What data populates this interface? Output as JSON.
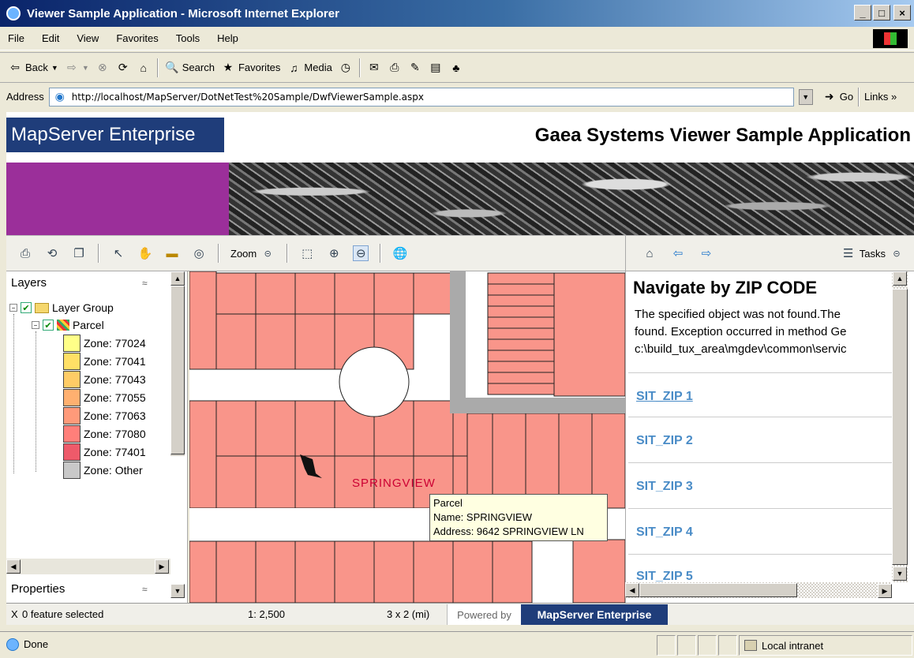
{
  "window": {
    "title": "Viewer Sample Application - Microsoft Internet Explorer",
    "controls": [
      "_",
      "□",
      "×"
    ]
  },
  "menu": [
    "File",
    "Edit",
    "View",
    "Favorites",
    "Tools",
    "Help"
  ],
  "toolbar": {
    "back": "Back",
    "search": "Search",
    "favorites": "Favorites",
    "media": "Media"
  },
  "address": {
    "label": "Address",
    "url": "http://localhost/MapServer/DotNetTest%20Sample/DwfViewerSample.aspx",
    "go": "Go",
    "links": "Links »"
  },
  "header": {
    "brand": "MapServer Enterprise",
    "app_title": "Gaea Systems Viewer Sample Application"
  },
  "map_toolbar": {
    "zoom_label": "Zoom",
    "tasks_label": "Tasks"
  },
  "layers": {
    "title": "Layers",
    "group": "Layer Group",
    "layer": "Parcel",
    "zones": [
      {
        "label": "Zone: 77024",
        "color": "#ffff88"
      },
      {
        "label": "Zone: 77041",
        "color": "#ffe066"
      },
      {
        "label": "Zone: 77043",
        "color": "#ffcc66"
      },
      {
        "label": "Zone: 77055",
        "color": "#ffb070"
      },
      {
        "label": "Zone: 77063",
        "color": "#ff9a7a"
      },
      {
        "label": "Zone: 77080",
        "color": "#ff7f7a"
      },
      {
        "label": "Zone:  77401",
        "color": "#ee5a6a"
      },
      {
        "label": "Zone: Other",
        "color": "#c8c8c8"
      }
    ]
  },
  "properties": {
    "title": "Properties"
  },
  "map": {
    "street_label": "SPRINGVIEW",
    "tooltip": {
      "line1": "Parcel",
      "line2": "Name: SPRINGVIEW",
      "line3": "Address: 9642 SPRINGVIEW LN"
    },
    "parcel_color": "#f9958a"
  },
  "task_pane": {
    "title": "Navigate by ZIP CODE",
    "error_lines": [
      "The specified object was not found.The",
      "found. Exception occurred in method Ge",
      "c:\\build_tux_area\\mgdev\\common\\servic"
    ],
    "zips": [
      "SIT_ZIP 1",
      "SIT_ZIP 2",
      "SIT_ZIP 3",
      "SIT_ZIP 4",
      "SIT_ZIP 5"
    ]
  },
  "map_status": {
    "selection": "0 feature selected",
    "selection_prefix": "X",
    "scale": "1: 2,500",
    "size": "3 x 2 (mi)",
    "powered_by": "Powered by",
    "powered_brand": "MapServer Enterprise"
  },
  "ie_status": {
    "state": "Done",
    "zone": "Local intranet"
  }
}
